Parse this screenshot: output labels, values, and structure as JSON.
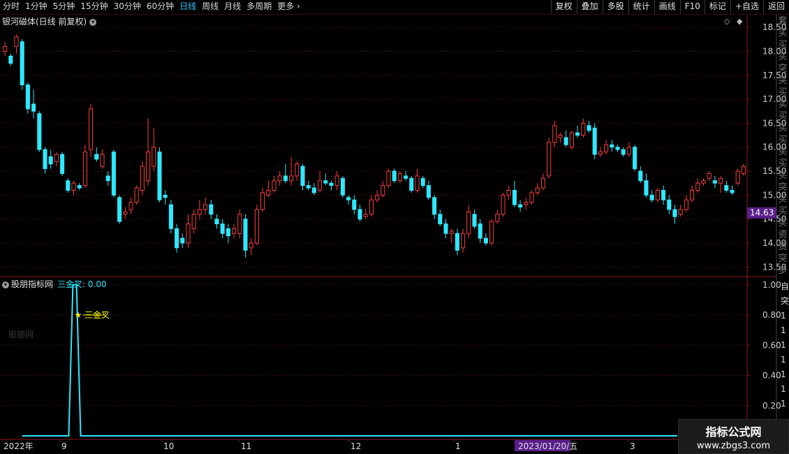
{
  "toolbar": {
    "periods": [
      "分时",
      "1分钟",
      "5分钟",
      "15分钟",
      "30分钟",
      "60分钟",
      "日线",
      "周线",
      "月线",
      "多周期",
      "更多"
    ],
    "active_period": "日线",
    "tools": [
      "复权",
      "叠加",
      "多股",
      "统计",
      "画线",
      "F10",
      "标记",
      "+自选",
      "返回"
    ]
  },
  "main_chart": {
    "title": "银河磁体(日线 前复权)",
    "price_tag": "14.63",
    "y_ticks": [
      "18.50",
      "18.00",
      "17.50",
      "17.00",
      "16.50",
      "16.00",
      "15.50",
      "15.00",
      "14.50",
      "14.00",
      "13.50"
    ],
    "right_strip_text": [
      "套",
      "买",
      "买",
      "买",
      "突",
      "突",
      "买",
      "实",
      "买",
      "买",
      "买",
      "买",
      "买",
      "买",
      "突",
      "买",
      "买",
      "买",
      "资",
      "资",
      "突",
      "多",
      "扎",
      "资",
      "收"
    ]
  },
  "indicator": {
    "name": "股朋指标网",
    "series_label": "三金叉: 0.00",
    "signal_label": "三金叉",
    "y_ticks": [
      "1.00",
      "0.80",
      "0.60",
      "0.40",
      "0.20"
    ],
    "watermark": "股朋网",
    "right_strip_text": [
      "自",
      "突",
      "1",
      "1",
      "1",
      "1",
      "1",
      "1",
      "1"
    ]
  },
  "x_axis": {
    "labels": [
      "2022年",
      "9",
      "10",
      "11",
      "12",
      "1",
      "2023/01/20/五",
      "3"
    ]
  },
  "logo": {
    "line1": "指标公式网",
    "line2": "www.zbgs3.com"
  },
  "colors": {
    "up": "#ff3d3d",
    "down": "#2ee8ff",
    "grid": "#4a0d0d",
    "axis": "#8b1a1a",
    "price_tag_bg": "#5a1f8a",
    "signal": "#ffff00"
  },
  "chart_data": {
    "type": "candlestick",
    "title": "银河磁体(日线 前复权)",
    "ylim": [
      13.3,
      18.75
    ],
    "candles": [
      [
        18.0,
        18.1,
        17.9,
        18.2
      ],
      [
        17.9,
        17.75,
        17.7,
        17.95
      ],
      [
        18.1,
        18.3,
        17.95,
        18.35
      ],
      [
        18.2,
        17.3,
        17.2,
        18.25
      ],
      [
        17.3,
        16.8,
        16.7,
        17.35
      ],
      [
        16.9,
        16.75,
        16.6,
        17.2
      ],
      [
        16.7,
        15.95,
        15.9,
        16.75
      ],
      [
        15.95,
        15.55,
        15.45,
        16.0
      ],
      [
        15.8,
        15.65,
        15.55,
        15.95
      ],
      [
        15.7,
        15.85,
        15.6,
        15.9
      ],
      [
        15.85,
        15.45,
        15.4,
        15.9
      ],
      [
        15.3,
        15.1,
        15.05,
        15.35
      ],
      [
        15.1,
        15.25,
        15.0,
        15.3
      ],
      [
        15.2,
        15.15,
        15.1,
        15.25
      ],
      [
        15.2,
        15.9,
        15.15,
        16.05
      ],
      [
        15.95,
        16.8,
        15.8,
        16.9
      ],
      [
        15.85,
        15.75,
        15.7,
        16.0
      ],
      [
        15.6,
        15.85,
        15.55,
        15.95
      ],
      [
        15.4,
        15.3,
        15.2,
        15.5
      ],
      [
        15.9,
        15.0,
        14.95,
        15.95
      ],
      [
        14.95,
        14.45,
        14.4,
        15.0
      ],
      [
        14.6,
        14.65,
        14.5,
        14.75
      ],
      [
        14.7,
        14.85,
        14.6,
        14.95
      ],
      [
        14.85,
        15.15,
        14.8,
        15.2
      ],
      [
        15.1,
        15.6,
        15.0,
        15.7
      ],
      [
        15.3,
        15.9,
        15.2,
        16.6
      ],
      [
        15.6,
        16.0,
        15.5,
        16.4
      ],
      [
        15.9,
        14.9,
        14.85,
        16.0
      ],
      [
        15.0,
        14.95,
        14.8,
        15.1
      ],
      [
        14.8,
        14.3,
        14.2,
        14.9
      ],
      [
        14.3,
        13.9,
        13.8,
        14.4
      ],
      [
        14.1,
        14.0,
        13.9,
        14.2
      ],
      [
        14.0,
        14.4,
        13.9,
        14.6
      ],
      [
        14.3,
        14.6,
        14.2,
        14.7
      ],
      [
        14.6,
        14.7,
        14.5,
        14.9
      ],
      [
        14.7,
        14.8,
        14.6,
        14.95
      ],
      [
        14.8,
        14.6,
        14.5,
        14.9
      ],
      [
        14.5,
        14.4,
        14.3,
        14.6
      ],
      [
        14.4,
        14.2,
        14.1,
        14.5
      ],
      [
        14.3,
        14.15,
        14.0,
        14.4
      ],
      [
        14.2,
        14.3,
        14.1,
        14.4
      ],
      [
        14.2,
        14.6,
        14.1,
        14.7
      ],
      [
        14.5,
        13.85,
        13.7,
        14.6
      ],
      [
        13.9,
        14.0,
        13.75,
        14.1
      ],
      [
        14.0,
        14.7,
        13.95,
        14.8
      ],
      [
        14.7,
        15.05,
        14.65,
        15.15
      ],
      [
        15.0,
        15.1,
        14.95,
        15.3
      ],
      [
        15.1,
        15.3,
        15.05,
        15.4
      ],
      [
        15.3,
        15.4,
        15.2,
        15.5
      ],
      [
        15.4,
        15.3,
        15.25,
        15.65
      ],
      [
        15.3,
        15.4,
        15.2,
        15.8
      ],
      [
        15.4,
        15.65,
        15.3,
        15.7
      ],
      [
        15.6,
        15.2,
        15.1,
        15.65
      ],
      [
        15.2,
        15.15,
        15.1,
        15.3
      ],
      [
        15.15,
        15.05,
        15.0,
        15.25
      ],
      [
        15.1,
        15.3,
        15.05,
        15.5
      ],
      [
        15.3,
        15.25,
        15.2,
        15.45
      ],
      [
        15.25,
        15.2,
        15.1,
        15.3
      ],
      [
        15.2,
        15.4,
        15.1,
        15.5
      ],
      [
        15.35,
        15.0,
        14.95,
        15.4
      ],
      [
        14.95,
        14.9,
        14.8,
        15.0
      ],
      [
        14.9,
        14.7,
        14.6,
        15.0
      ],
      [
        14.7,
        14.5,
        14.45,
        14.8
      ],
      [
        14.55,
        14.6,
        14.5,
        14.7
      ],
      [
        14.6,
        14.9,
        14.55,
        15.0
      ],
      [
        14.9,
        15.0,
        14.85,
        15.1
      ],
      [
        15.0,
        15.2,
        14.95,
        15.3
      ],
      [
        15.2,
        15.5,
        15.15,
        15.55
      ],
      [
        15.5,
        15.3,
        15.25,
        15.55
      ],
      [
        15.3,
        15.45,
        15.25,
        15.5
      ],
      [
        15.4,
        15.35,
        15.3,
        15.5
      ],
      [
        15.35,
        15.1,
        15.05,
        15.4
      ],
      [
        15.1,
        15.4,
        15.05,
        15.55
      ],
      [
        15.35,
        15.2,
        15.15,
        15.4
      ],
      [
        15.2,
        14.95,
        14.9,
        15.3
      ],
      [
        14.95,
        14.6,
        14.5,
        15.0
      ],
      [
        14.6,
        14.4,
        14.35,
        14.7
      ],
      [
        14.4,
        14.2,
        14.1,
        14.5
      ],
      [
        14.2,
        14.25,
        14.0,
        14.3
      ],
      [
        14.2,
        13.85,
        13.75,
        14.3
      ],
      [
        13.9,
        14.2,
        13.8,
        14.3
      ],
      [
        14.2,
        14.65,
        14.1,
        14.8
      ],
      [
        14.6,
        14.35,
        14.3,
        14.7
      ],
      [
        14.4,
        14.1,
        14.0,
        14.5
      ],
      [
        14.1,
        14.0,
        13.95,
        14.2
      ],
      [
        14.0,
        14.45,
        13.95,
        14.5
      ],
      [
        14.45,
        14.6,
        14.4,
        14.7
      ],
      [
        14.6,
        15.0,
        14.55,
        15.05
      ],
      [
        15.0,
        15.1,
        14.9,
        15.2
      ],
      [
        15.1,
        14.8,
        14.75,
        15.3
      ],
      [
        14.8,
        14.75,
        14.65,
        14.9
      ],
      [
        14.8,
        14.85,
        14.7,
        14.95
      ],
      [
        14.85,
        15.05,
        14.8,
        15.1
      ],
      [
        15.05,
        15.15,
        15.0,
        15.25
      ],
      [
        15.15,
        15.35,
        15.1,
        15.45
      ],
      [
        15.4,
        16.1,
        15.35,
        16.2
      ],
      [
        16.1,
        16.45,
        16.0,
        16.55
      ],
      [
        16.2,
        16.25,
        16.1,
        16.3
      ],
      [
        16.2,
        16.05,
        16.0,
        16.35
      ],
      [
        16.0,
        16.3,
        15.95,
        16.35
      ],
      [
        16.3,
        16.25,
        16.2,
        16.45
      ],
      [
        16.25,
        16.5,
        16.2,
        16.6
      ],
      [
        16.45,
        16.35,
        16.3,
        16.55
      ],
      [
        16.4,
        15.85,
        15.75,
        16.5
      ],
      [
        15.85,
        15.9,
        15.8,
        16.0
      ],
      [
        15.9,
        16.05,
        15.85,
        16.15
      ],
      [
        16.05,
        16.0,
        15.9,
        16.15
      ],
      [
        16.0,
        15.95,
        15.9,
        16.05
      ],
      [
        15.95,
        15.85,
        15.8,
        16.0
      ],
      [
        15.85,
        16.0,
        15.8,
        16.1
      ],
      [
        16.0,
        15.55,
        15.5,
        16.05
      ],
      [
        15.5,
        15.3,
        15.25,
        15.6
      ],
      [
        15.3,
        15.0,
        14.95,
        15.45
      ],
      [
        15.0,
        14.9,
        14.85,
        15.1
      ],
      [
        14.9,
        15.1,
        14.85,
        15.15
      ],
      [
        15.1,
        14.9,
        14.8,
        15.2
      ],
      [
        14.9,
        14.7,
        14.6,
        15.0
      ],
      [
        14.7,
        14.55,
        14.4,
        14.8
      ],
      [
        14.6,
        14.7,
        14.55,
        14.8
      ],
      [
        14.7,
        14.9,
        14.65,
        15.0
      ],
      [
        14.9,
        15.1,
        14.85,
        15.2
      ],
      [
        15.1,
        15.25,
        15.05,
        15.35
      ],
      [
        15.25,
        15.3,
        15.2,
        15.35
      ],
      [
        15.35,
        15.45,
        15.3,
        15.5
      ],
      [
        15.3,
        15.25,
        15.15,
        15.4
      ],
      [
        15.25,
        15.35,
        15.05,
        15.4
      ],
      [
        15.2,
        15.1,
        15.05,
        15.3
      ],
      [
        15.1,
        15.05,
        15.0,
        15.2
      ],
      [
        15.25,
        15.5,
        15.2,
        15.55
      ],
      [
        15.45,
        15.6,
        15.4,
        15.65
      ]
    ]
  },
  "indicator_data": {
    "type": "line",
    "ylim": [
      0,
      1.05
    ],
    "spike_start": 0.092,
    "spike_end": 0.108,
    "spike_value": 1.0,
    "baseline": 0.0
  }
}
